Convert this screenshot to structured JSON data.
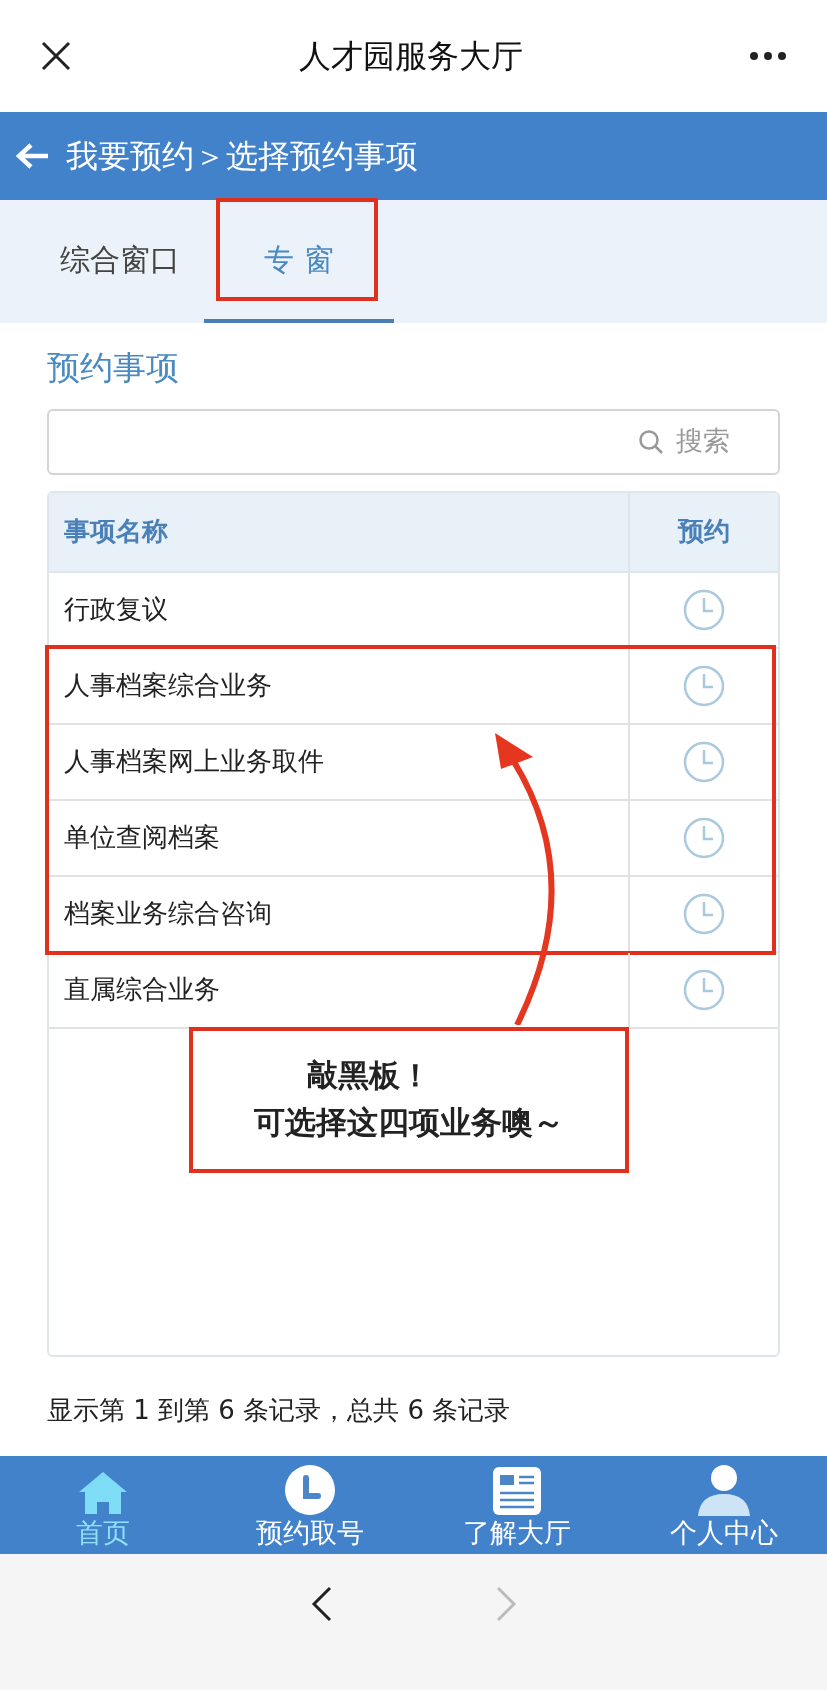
{
  "top_bar": {
    "title": "人才园服务大厅"
  },
  "header": {
    "breadcrumb": "我要预约＞选择预约事项"
  },
  "tabs": [
    {
      "label": "综合窗口",
      "selected": false,
      "highlighted": false
    },
    {
      "label": "专 窗",
      "selected": true,
      "highlighted": true
    }
  ],
  "section_title": "预约事项",
  "search": {
    "placeholder": "搜索"
  },
  "table": {
    "columns": [
      "事项名称",
      "预约"
    ],
    "rows": [
      {
        "name": "行政复议",
        "highlighted": false
      },
      {
        "name": "人事档案综合业务",
        "highlighted": true
      },
      {
        "name": "人事档案网上业务取件",
        "highlighted": true
      },
      {
        "name": "单位查阅档案",
        "highlighted": true
      },
      {
        "name": "档案业务综合咨询",
        "highlighted": true
      },
      {
        "name": "直属综合业务",
        "highlighted": false
      }
    ]
  },
  "callout": {
    "lines": [
      "敲黑板！",
      "可选择这四项业务噢～"
    ]
  },
  "footer": "显示第 1 到第 6 条记录，总共 6 条记录",
  "bottom_nav": [
    {
      "label": "首页",
      "kind": "home",
      "selected": true
    },
    {
      "label": "预约取号",
      "kind": "clock",
      "selected": false
    },
    {
      "label": "了解大厅",
      "kind": "news",
      "selected": false
    },
    {
      "label": "个人中心",
      "kind": "person",
      "selected": false
    }
  ],
  "browser_nav": {
    "back_disabled": false,
    "forward_disabled": true
  }
}
